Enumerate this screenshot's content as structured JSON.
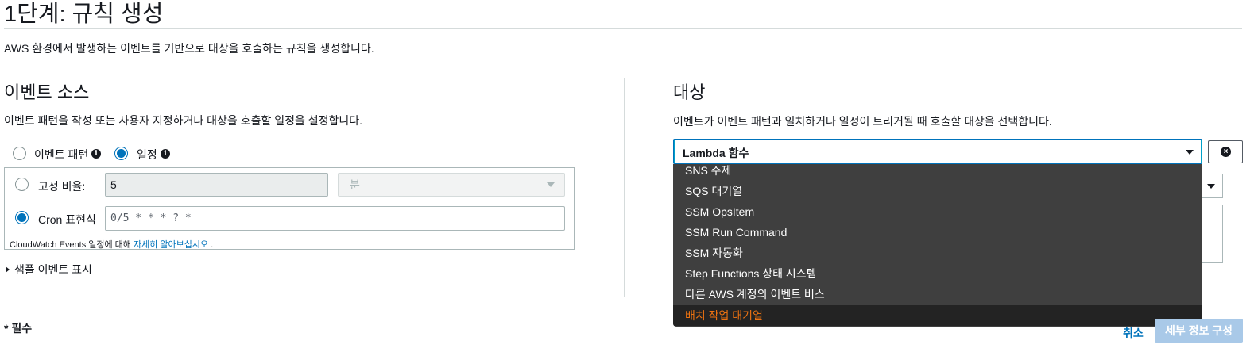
{
  "page": {
    "title": "1단계: 규칙 생성",
    "description": "AWS 환경에서 발생하는 이벤트를 기반으로 대상을 호출하는 규칙을 생성합니다."
  },
  "event_source": {
    "title": "이벤트 소스",
    "description": "이벤트 패턴을 작성 또는 사용자 지정하거나 대상을 호출할 일정을 설정합니다.",
    "mode_options": [
      {
        "label": "이벤트 패턴",
        "selected": false
      },
      {
        "label": "일정",
        "selected": true
      }
    ],
    "info_icon": "info-icon",
    "fixed_rate": {
      "label": "고정 비율:",
      "value": "5",
      "unit_placeholder": "분",
      "selected": false
    },
    "cron": {
      "label": "Cron 표현식",
      "value": "0/5 * * * ? *",
      "selected": true
    },
    "note_prefix": "CloudWatch Events 일정에 대해",
    "note_link": "자세히 알아보십시오",
    "note_suffix": ".",
    "sample_events_toggle": "샘플 이벤트 표시"
  },
  "targets": {
    "title": "대상",
    "description": "이벤트가 이벤트 패턴과 일치하거나 일정이 트리거될 때 호출할 대상을 선택합니다.",
    "selected_target": "Lambda 함수",
    "remove_icon": "close-circle-icon",
    "dropdown_options": [
      {
        "label": "SNS 주제",
        "selected": false
      },
      {
        "label": "SQS 대기열",
        "selected": false
      },
      {
        "label": "SSM OpsItem",
        "selected": false
      },
      {
        "label": "SSM Run Command",
        "selected": false
      },
      {
        "label": "SSM 자동화",
        "selected": false
      },
      {
        "label": "Step Functions 상태 시스템",
        "selected": false
      },
      {
        "label": "다른 AWS 계정의 이벤트 버스",
        "selected": false
      },
      {
        "label": "배치 작업 대기열",
        "selected": true
      }
    ]
  },
  "footer": {
    "required_note": "* 필수",
    "cancel_label": "취소",
    "next_label": "세부 정보 구성"
  },
  "colors": {
    "link": "#0073bb",
    "dropdown_bg": "#3f3f3f",
    "dropdown_selected_text": "#ec7211",
    "primary_button_disabled": "#a9c9e8"
  }
}
